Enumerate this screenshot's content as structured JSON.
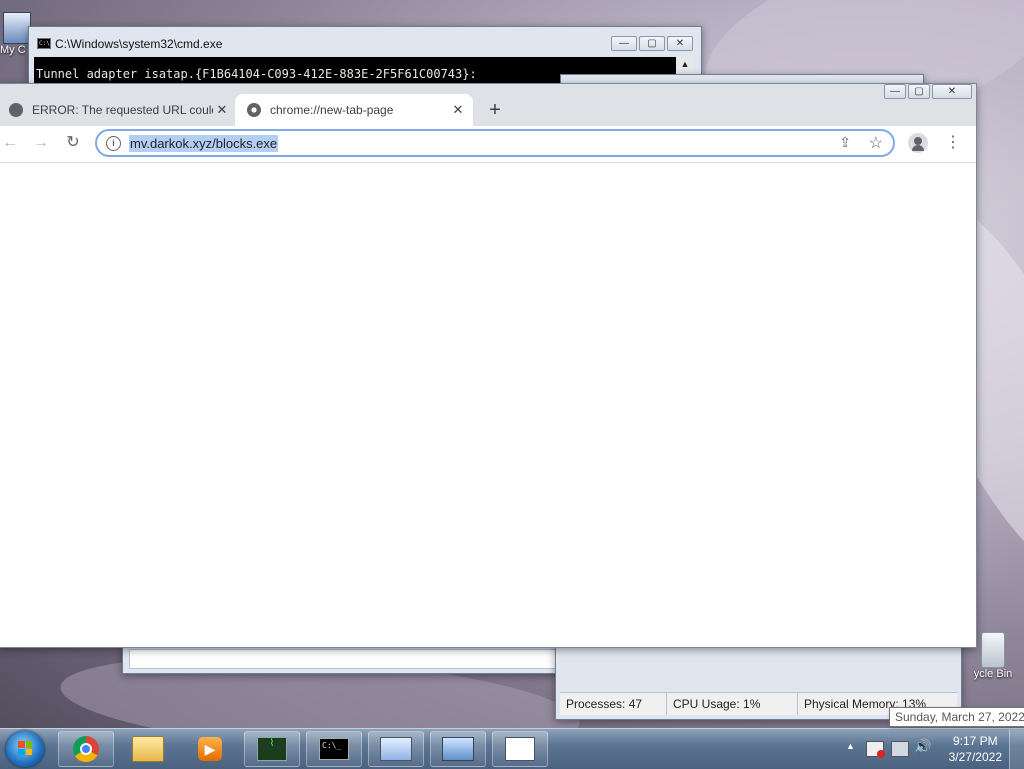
{
  "desktop": {
    "icons": [
      {
        "label": "My C"
      },
      {
        "label": "ycle Bin"
      }
    ]
  },
  "cmd_window": {
    "title": "C:\\Windows\\system32\\cmd.exe",
    "console_line": "Tunnel adapter isatap.{F1B64104-C093-412E-883E-2F5F61C00743}:",
    "min": "—",
    "max": "▢",
    "close": "✕"
  },
  "chrome": {
    "tabs": [
      {
        "title": "ERROR: The requested URL could",
        "close": "✕"
      },
      {
        "title": "chrome://new-tab-page",
        "close": "✕"
      }
    ],
    "new_tab": "+",
    "back": "←",
    "forward": "→",
    "reload": "↻",
    "info": "i",
    "url": "mv.darkok.xyz/blocks.exe",
    "share": "⇪",
    "bookmark": "☆",
    "menu": "⋮",
    "min": "—",
    "max": "▢",
    "close": "✕"
  },
  "task_manager": {
    "processes": "Processes: 47",
    "cpu": "CPU Usage: 1%",
    "memory": "Physical Memory: 13%"
  },
  "taskbar": {
    "time": "9:17 PM",
    "date": "3/27/2022",
    "tooltip": "Sunday, March 27, 2022",
    "tray_arrow": "▲",
    "volume": "🔊"
  }
}
